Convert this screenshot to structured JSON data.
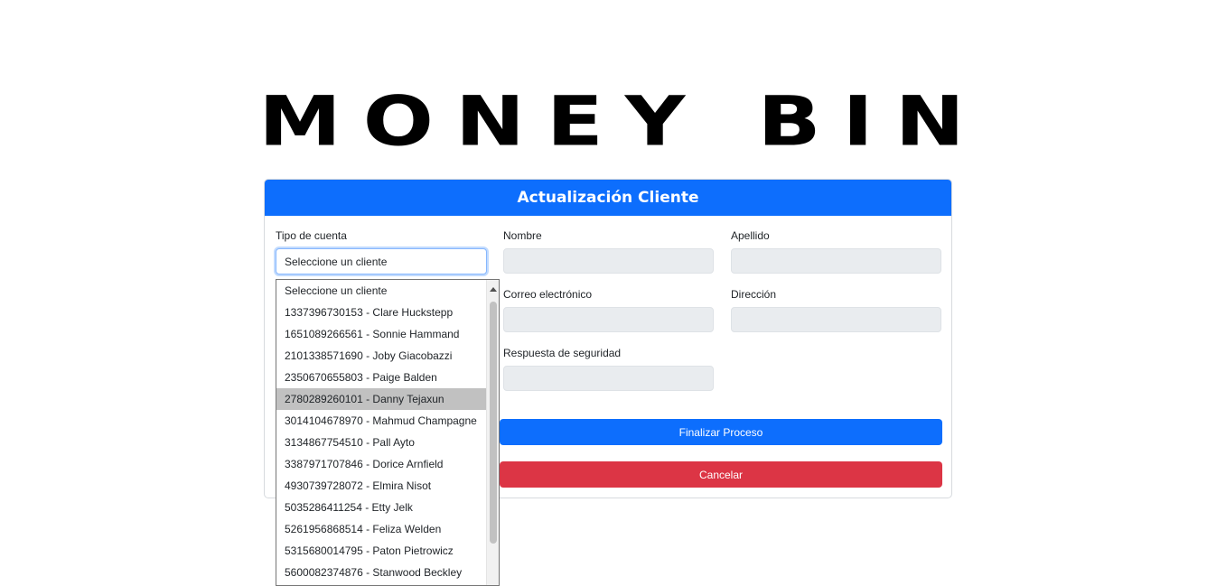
{
  "logo": {
    "text": "MONEY BIN"
  },
  "card": {
    "title": "Actualización Cliente"
  },
  "form": {
    "account_type_label": "Tipo de cuenta",
    "account_select_value": "Seleccione un cliente",
    "nombre_label": "Nombre",
    "apellido_label": "Apellido",
    "correo_label": "Correo electrónico",
    "direccion_label": "Dirección",
    "respuesta_label": "Respuesta de seguridad",
    "finalize_button": "Finalizar Proceso",
    "cancel_button": "Cancelar"
  },
  "dropdown": {
    "options": [
      "Seleccione un cliente",
      "1337396730153 - Clare Huckstepp",
      "1651089266561 - Sonnie Hammand",
      "2101338571690 - Joby Giacobazzi",
      "2350670655803 - Paige Balden",
      "2780289260101 - Danny Tejaxun",
      "3014104678970 - Mahmud Champagne",
      "3134867754510 - Pall Ayto",
      "3387971707846 - Dorice Arnfield",
      "4930739728072 - Elmira Nisot",
      "5035286411254 - Etty Jelk",
      "5261956868514 - Feliza Welden",
      "5315680014795 - Paton Pietrowicz",
      "5600082374876 - Stanwood Beckley"
    ],
    "highlighted": "2780289260101 - Danny Tejaxun"
  },
  "colors": {
    "primary": "#0d6efd",
    "danger": "#dc3545",
    "highlight": "#c1c1c1"
  }
}
